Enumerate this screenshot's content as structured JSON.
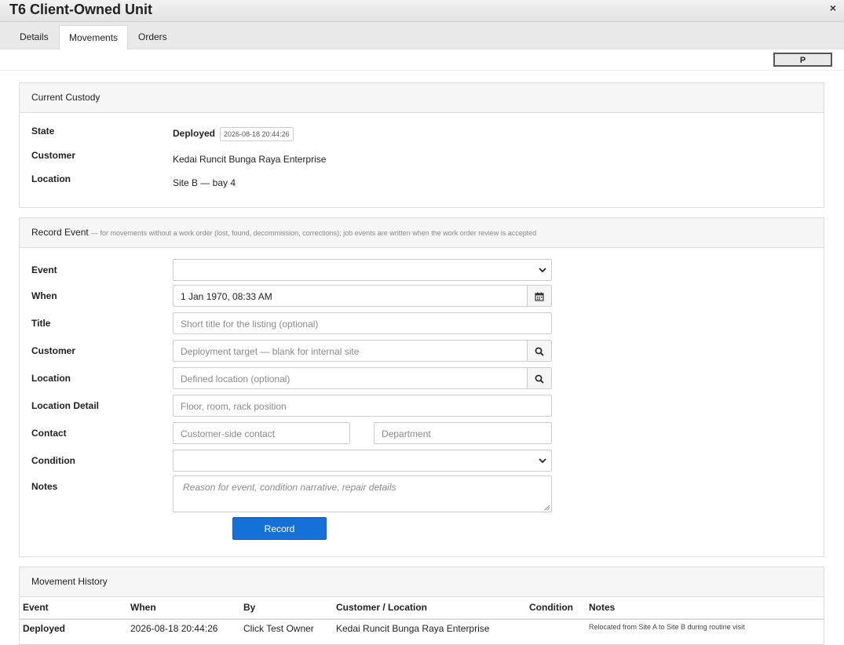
{
  "window": {
    "title": "T6 Client-Owned Unit",
    "close_glyph": "×"
  },
  "tabs": [
    {
      "label": "Details"
    },
    {
      "label": "Movements"
    },
    {
      "label": "Orders"
    }
  ],
  "toolbar": {
    "p_button": "P"
  },
  "custody": {
    "heading": "Current Custody",
    "state_label": "State",
    "state_value": "Deployed",
    "state_timestamp": "2026-08-18 20:44:26",
    "customer_label": "Customer",
    "customer_value": "Kedai Runcit Bunga Raya Enterprise",
    "location_label": "Location",
    "location_value": "Site B — bay 4"
  },
  "record": {
    "heading": "Record Event",
    "subheading": "— for movements without a work order (lost, found, decommission, corrections); job events are written when the work order review is accepted",
    "event_label": "Event",
    "when_label": "When",
    "when_value": "1 Jan 1970, 08:33 AM",
    "title_label": "Title",
    "title_placeholder": "Short title for the listing (optional)",
    "customer_label": "Customer",
    "customer_placeholder": "Deployment target — blank for internal site",
    "location_label": "Location",
    "location_placeholder": "Defined location (optional)",
    "location_detail_label": "Location Detail",
    "location_detail_placeholder": "Floor, room, rack position",
    "contact_label": "Contact",
    "contact_placeholder": "Customer-side contact",
    "department_placeholder": "Department",
    "condition_label": "Condition",
    "notes_label": "Notes",
    "notes_placeholder": "Reason for event, condition narrative, repair details",
    "record_button": "Record"
  },
  "history": {
    "heading": "Movement History",
    "columns": [
      "Event",
      "When",
      "By",
      "Customer / Location",
      "Condition",
      "Notes"
    ],
    "rows": [
      {
        "event": "Deployed",
        "when": "2026-08-18 20:44:26",
        "by": "Click Test Owner",
        "customer": "Kedai Runcit Bunga Raya Enterprise",
        "condition": "",
        "notes": "Relocated from Site A to Site B during routine visit"
      }
    ]
  },
  "icons": {
    "calendar": "calendar-icon",
    "search": "search-icon",
    "chevron": "chevron-down-icon",
    "close": "close-icon"
  }
}
